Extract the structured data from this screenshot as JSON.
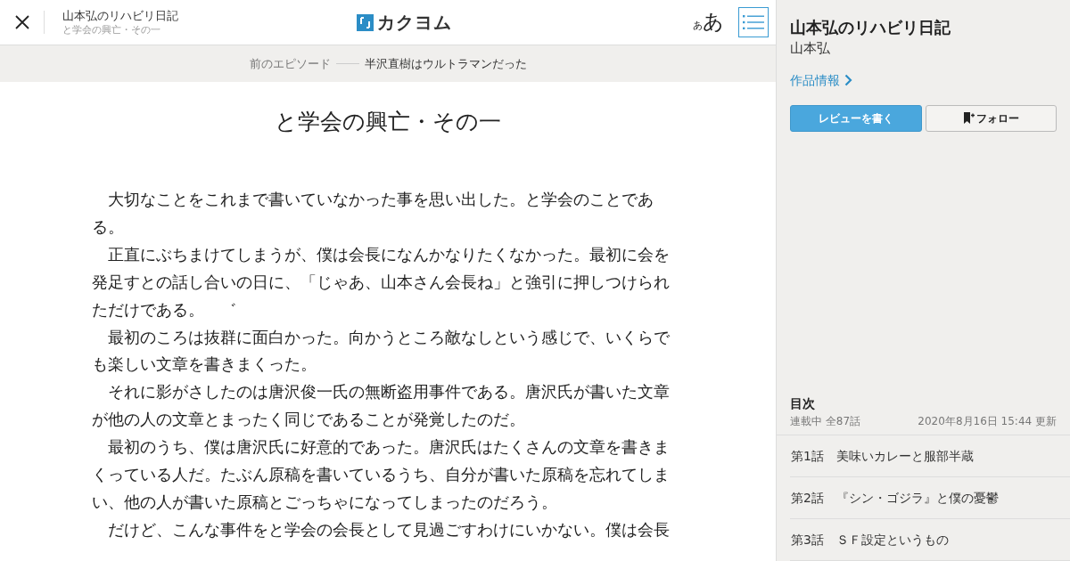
{
  "header": {
    "work_title": "山本弘のリハビリ日記",
    "episode_title": "と学会の興亡・その一",
    "logo": "カクヨム",
    "font_size_small": "あ",
    "font_size_large": "あ"
  },
  "prev_episode": {
    "label": "前のエピソード",
    "title": "半沢直樹はウルトラマンだった"
  },
  "episode": {
    "title": "と学会の興亡・その一",
    "paragraphs": [
      "大切なことをこれまで書いていなかった事を思い出した。と学会のことである。",
      "正直にぶちまけてしまうが、僕は会長になんかなりたくなかった。最初に会を発足すとの話し合いの日に、「じゃあ、山本さん会長ね」と強引に押しつけられただけである。　゛",
      "最初のころは抜群に面白かった。向かうところ敵なしという感じで、いくらでも楽しい文章を書きまくった。",
      "それに影がさしたのは唐沢俊一氏の無断盗用事件である。唐沢氏が書いた文章が他の人の文章とまったく同じであることが発覚したのだ。",
      "最初のうち、僕は唐沢氏に好意的であった。唐沢氏はたくさんの文章を書きまくっている人だ。たぶん原稿を書いているうち、自分が書いた原稿を忘れてしまい、他の人が書いた原稿とごっちゃになってしまったのだろう。",
      "だけど、こんな事件をと学会の会長として見過ごすわけにいかない。僕は会長"
    ]
  },
  "sidebar": {
    "title": "山本弘のリハビリ日記",
    "author": "山本弘",
    "info_link": "作品情報",
    "buttons": [
      {
        "label": "レビューを書く",
        "kind": "primary"
      },
      {
        "label": "フォロー",
        "kind": "follow"
      }
    ],
    "toc": {
      "heading": "目次",
      "status": "連載中 全87話",
      "updated": "2020年8月16日 15:44 更新",
      "episodes": [
        {
          "number": "第1話",
          "title": "美味いカレーと服部半蔵"
        },
        {
          "number": "第2話",
          "title": "『シン・ゴジラ』と僕の憂鬱"
        },
        {
          "number": "第3話",
          "title": "ＳＦ設定というもの"
        }
      ]
    }
  }
}
